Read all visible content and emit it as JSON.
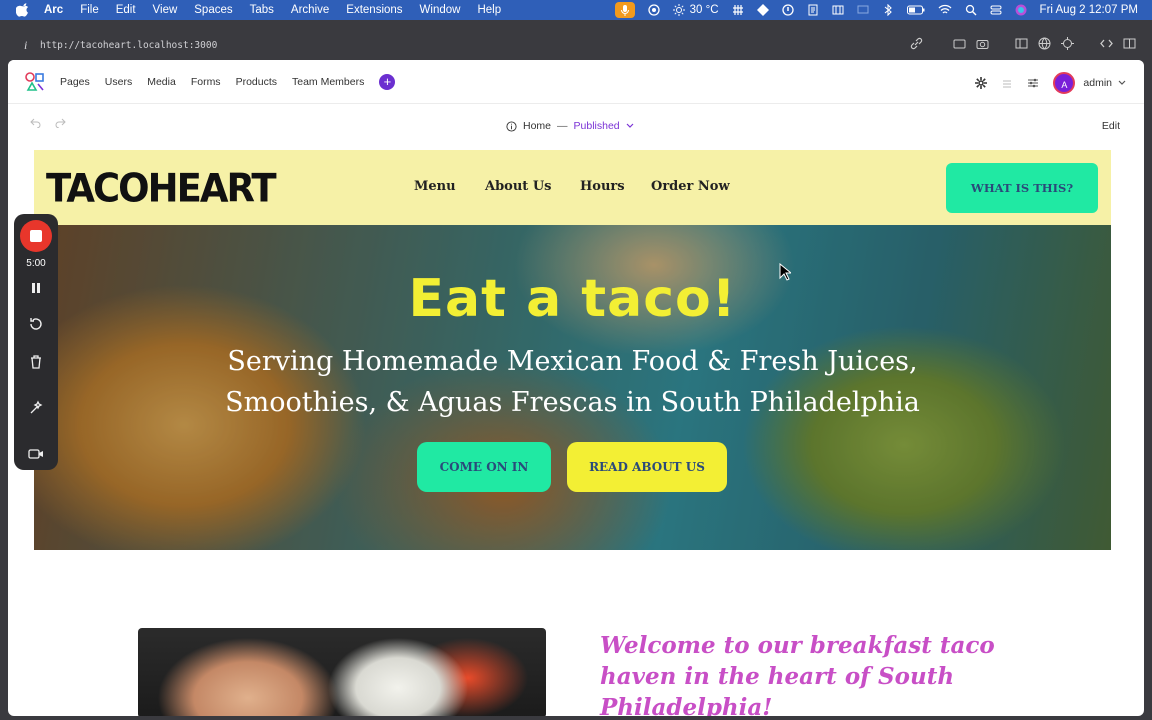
{
  "menubar": {
    "app": "Arc",
    "items": [
      "File",
      "Edit",
      "View",
      "Spaces",
      "Tabs",
      "Archive",
      "Extensions",
      "Window",
      "Help"
    ],
    "weather": "30 °C",
    "datetime": "Fri Aug 2  12:07 PM"
  },
  "browser": {
    "url": "http://tacoheart.localhost:3000"
  },
  "cms": {
    "nav": [
      "Pages",
      "Users",
      "Media",
      "Forms",
      "Products",
      "Team Members"
    ],
    "add_label": "+",
    "user_initial": "A",
    "user": "admin"
  },
  "pagebar": {
    "page": "Home",
    "separator": "—",
    "status": "Published",
    "edit": "Edit"
  },
  "site": {
    "brand": "TACOHEART",
    "nav": [
      "Menu",
      "About Us",
      "Hours",
      "Order Now"
    ],
    "cta": "WHAT IS THIS?",
    "hero_title": "Eat a taco!",
    "hero_subtitle_line1": "Serving Homemade Mexican Food & Fresh Juices,",
    "hero_subtitle_line2": "Smoothies, & Aguas Frescas in South Philadelphia",
    "btn_come_in": "COME ON IN",
    "btn_read": "READ ABOUT US",
    "welcome": "Welcome to our breakfast taco haven in the heart of South Philadelphia!"
  },
  "recorder": {
    "time": "5:00"
  },
  "colors": {
    "accent_green": "#20e9a3",
    "accent_yellow": "#f3ef34",
    "purple": "#7b33d6",
    "welcome_pink": "#c84fc6"
  }
}
